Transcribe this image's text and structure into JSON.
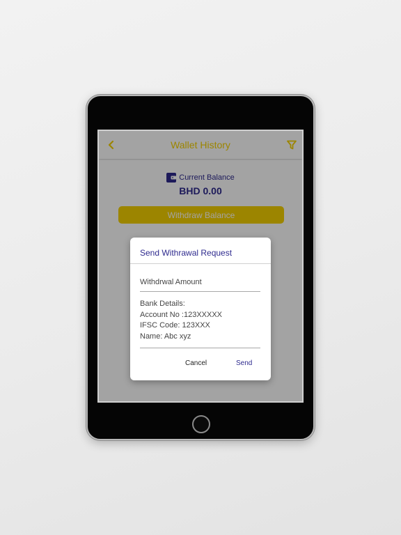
{
  "app_bar": {
    "title": "Wallet History",
    "back_icon": "chevron-left-icon",
    "filter_icon": "filter-icon",
    "accent_color": "#f5d000"
  },
  "balance": {
    "icon": "wallet-icon",
    "label": "Current Balance",
    "amount": "BHD 0.00",
    "text_color": "#2e2a8e"
  },
  "withdraw_button": {
    "label": "Withdraw Balance"
  },
  "dialog": {
    "title": "Send Withrawal Request",
    "amount_placeholder": "Withdrwal Amount",
    "bank_details": [
      "Bank Details:",
      "Account No :123XXXXX",
      "IFSC Code: 123XXX",
      "Name: Abc xyz"
    ],
    "cancel_label": "Cancel",
    "send_label": "Send"
  }
}
